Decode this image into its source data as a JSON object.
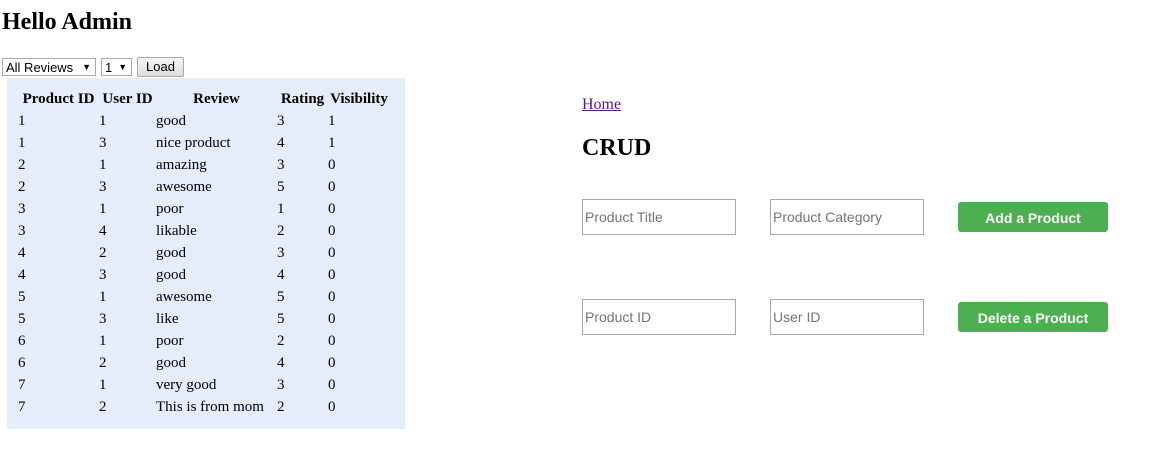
{
  "header": {
    "greeting": "Hello Admin"
  },
  "controls": {
    "review_filter": "All Reviews",
    "page_number": "1",
    "load_label": "Load"
  },
  "table": {
    "headers": [
      "Product ID",
      "User ID",
      "Review",
      "Rating",
      "Visibility"
    ],
    "rows": [
      [
        "1",
        "1",
        "good",
        "3",
        "1"
      ],
      [
        "1",
        "3",
        "nice product",
        "4",
        "1"
      ],
      [
        "2",
        "1",
        "amazing",
        "3",
        "0"
      ],
      [
        "2",
        "3",
        "awesome",
        "5",
        "0"
      ],
      [
        "3",
        "1",
        "poor",
        "1",
        "0"
      ],
      [
        "3",
        "4",
        "likable",
        "2",
        "0"
      ],
      [
        "4",
        "2",
        "good",
        "3",
        "0"
      ],
      [
        "4",
        "3",
        "good",
        "4",
        "0"
      ],
      [
        "5",
        "1",
        "awesome",
        "5",
        "0"
      ],
      [
        "5",
        "3",
        "like",
        "5",
        "0"
      ],
      [
        "6",
        "1",
        "poor",
        "2",
        "0"
      ],
      [
        "6",
        "2",
        "good",
        "4",
        "0"
      ],
      [
        "7",
        "1",
        "very good",
        "3",
        "0"
      ],
      [
        "7",
        "2",
        "This is from mom",
        "2",
        "0"
      ]
    ]
  },
  "nav": {
    "home_label": "Home"
  },
  "crud": {
    "title": "CRUD",
    "add_form": {
      "title_placeholder": "Product Title",
      "category_placeholder": "Product Category",
      "button_label": "Add a Product"
    },
    "delete_form": {
      "product_id_placeholder": "Product ID",
      "user_id_placeholder": "User ID",
      "button_label": "Delete a Product"
    }
  },
  "colors": {
    "table_background": "#e5edfb",
    "button_green": "#4caf50",
    "link_visited": "#551a8b"
  }
}
